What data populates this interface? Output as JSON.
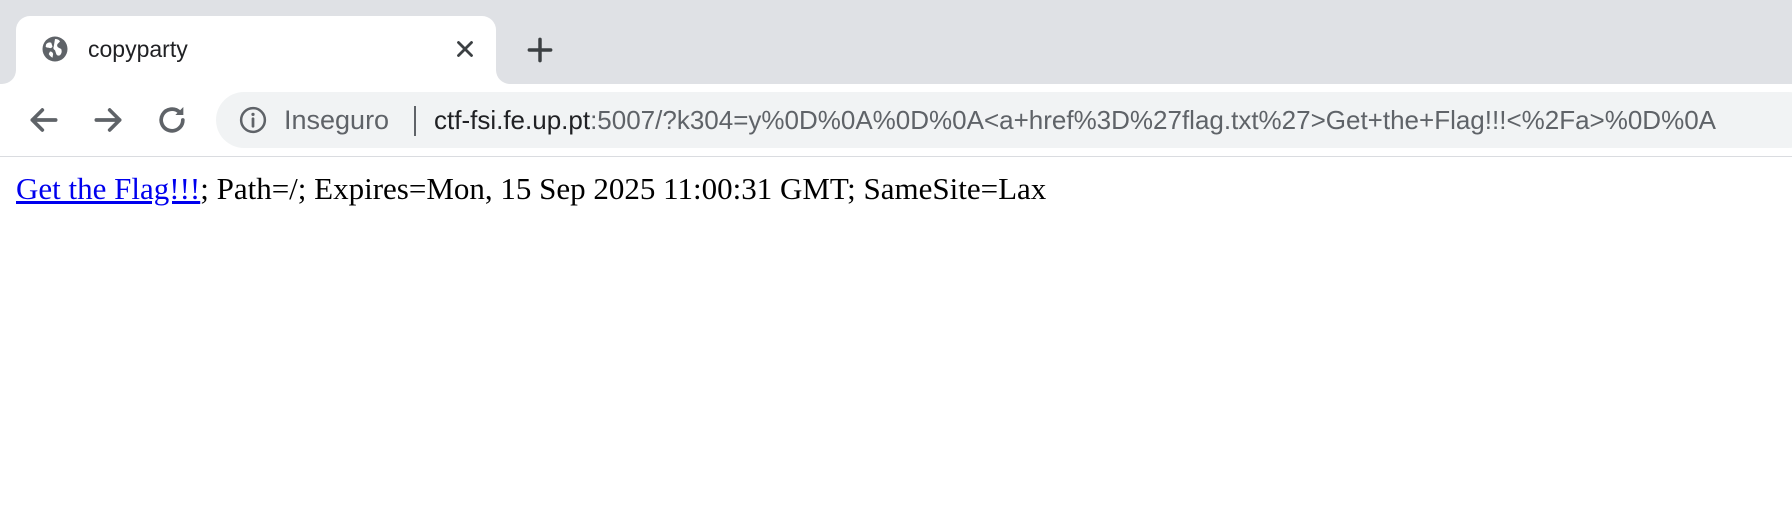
{
  "tab": {
    "favicon": "globe-icon",
    "title": "copyparty",
    "close_icon": "close-icon"
  },
  "new_tab_icon": "plus-icon",
  "toolbar": {
    "back_icon": "arrow-left-icon",
    "forward_icon": "arrow-right-icon",
    "reload_icon": "reload-icon"
  },
  "omnibox": {
    "security_icon": "info-icon",
    "security_label": "Inseguro",
    "url_host": "ctf-fsi.fe.up.pt",
    "url_rest": ":5007/?k304=y%0D%0A%0D%0A<a+href%3D%27flag.txt%27>Get+the+Flag!!!<%2Fa>%0D%0A"
  },
  "page": {
    "link_text": "Get the Flag!!!",
    "trailing_text": "; Path=/; Expires=Mon, 15 Sep 2025 11:00:31 GMT; SameSite=Lax"
  },
  "colors": {
    "tabstrip_bg": "#dfe1e5",
    "omnibox_bg": "#f1f3f4",
    "link": "#0000ee"
  }
}
